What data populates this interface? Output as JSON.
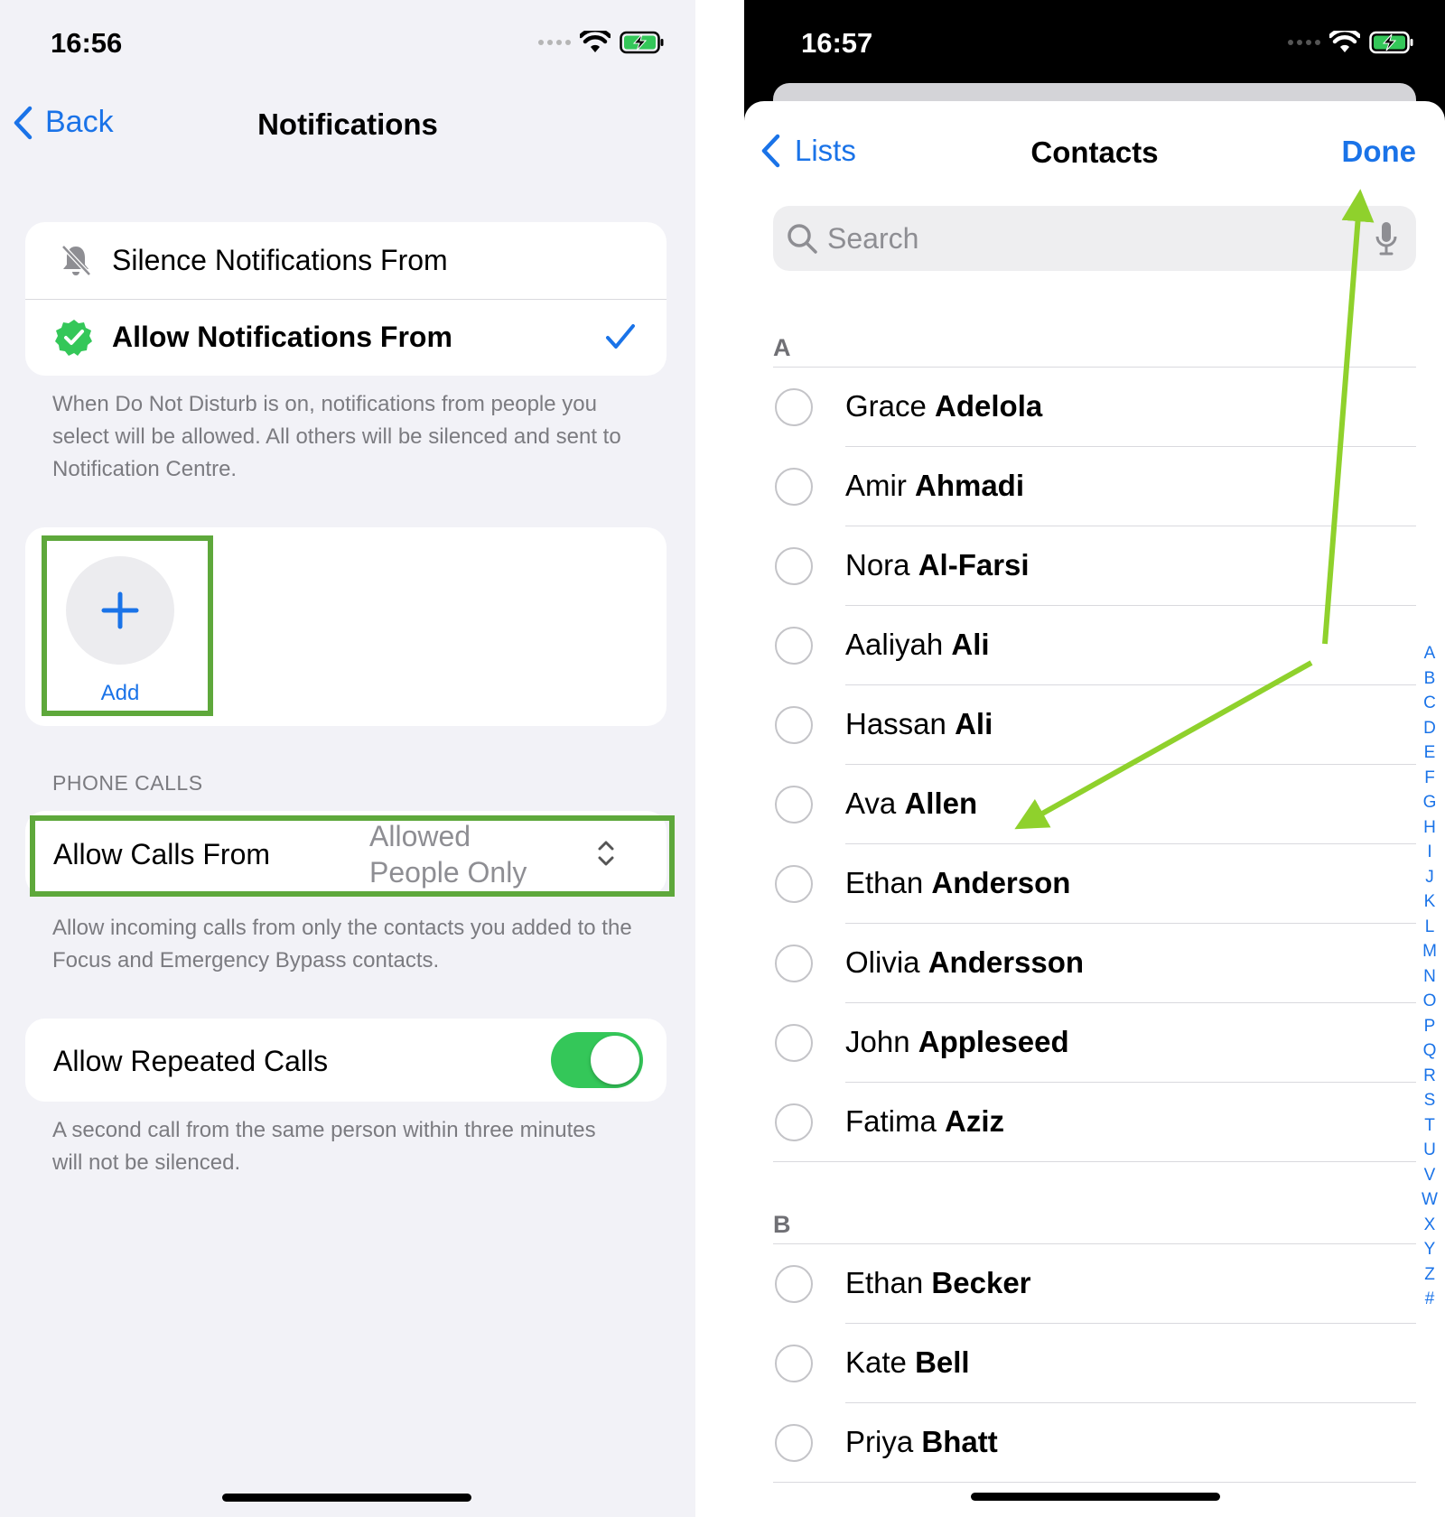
{
  "left": {
    "time": "16:56",
    "nav": {
      "back_label": "Back",
      "title": "Notifications"
    },
    "options": [
      {
        "label": "Silence Notifications From",
        "icon": "bell-slash-icon"
      },
      {
        "label": "Allow Notifications From",
        "icon": "verified-badge-icon",
        "checked": true
      }
    ],
    "options_hint": "When Do Not Disturb is on, notifications from people you select will be allowed. All others will be silenced and sent to Notification Centre.",
    "add_label": "Add",
    "phone_calls": {
      "header": "PHONE CALLS",
      "allow_calls_label": "Allow Calls From",
      "allow_calls_value": "Allowed People Only",
      "hint": "Allow incoming calls from only the contacts you added to the Focus and Emergency Bypass contacts."
    },
    "repeated": {
      "label": "Allow Repeated Calls",
      "enabled": true,
      "hint": "A second call from the same person within three minutes will not be silenced."
    }
  },
  "right": {
    "time": "16:57",
    "nav": {
      "lists_label": "Lists",
      "title": "Contacts",
      "done_label": "Done"
    },
    "search": {
      "placeholder": "Search"
    },
    "sections": [
      {
        "letter": "A",
        "contacts": [
          {
            "first": "Grace",
            "last": "Adelola"
          },
          {
            "first": "Amir",
            "last": "Ahmadi"
          },
          {
            "first": "Nora",
            "last": "Al-Farsi"
          },
          {
            "first": "Aaliyah",
            "last": "Ali"
          },
          {
            "first": "Hassan",
            "last": "Ali"
          },
          {
            "first": "Ava",
            "last": "Allen"
          },
          {
            "first": "Ethan",
            "last": "Anderson"
          },
          {
            "first": "Olivia",
            "last": "Andersson"
          },
          {
            "first": "John",
            "last": "Appleseed"
          },
          {
            "first": "Fatima",
            "last": "Aziz"
          }
        ]
      },
      {
        "letter": "B",
        "contacts": [
          {
            "first": "Ethan",
            "last": "Becker"
          },
          {
            "first": "Kate",
            "last": "Bell"
          },
          {
            "first": "Priya",
            "last": "Bhatt"
          }
        ]
      }
    ],
    "index_letters": [
      "A",
      "B",
      "C",
      "D",
      "E",
      "F",
      "G",
      "H",
      "I",
      "J",
      "K",
      "L",
      "M",
      "N",
      "O",
      "P",
      "Q",
      "R",
      "S",
      "T",
      "U",
      "V",
      "W",
      "X",
      "Y",
      "Z",
      "#"
    ]
  },
  "colors": {
    "accent": "#1a73e8",
    "highlight_box": "#5ea83b",
    "annotation_arrow": "#8fd12c",
    "toggle_on": "#34c759"
  }
}
